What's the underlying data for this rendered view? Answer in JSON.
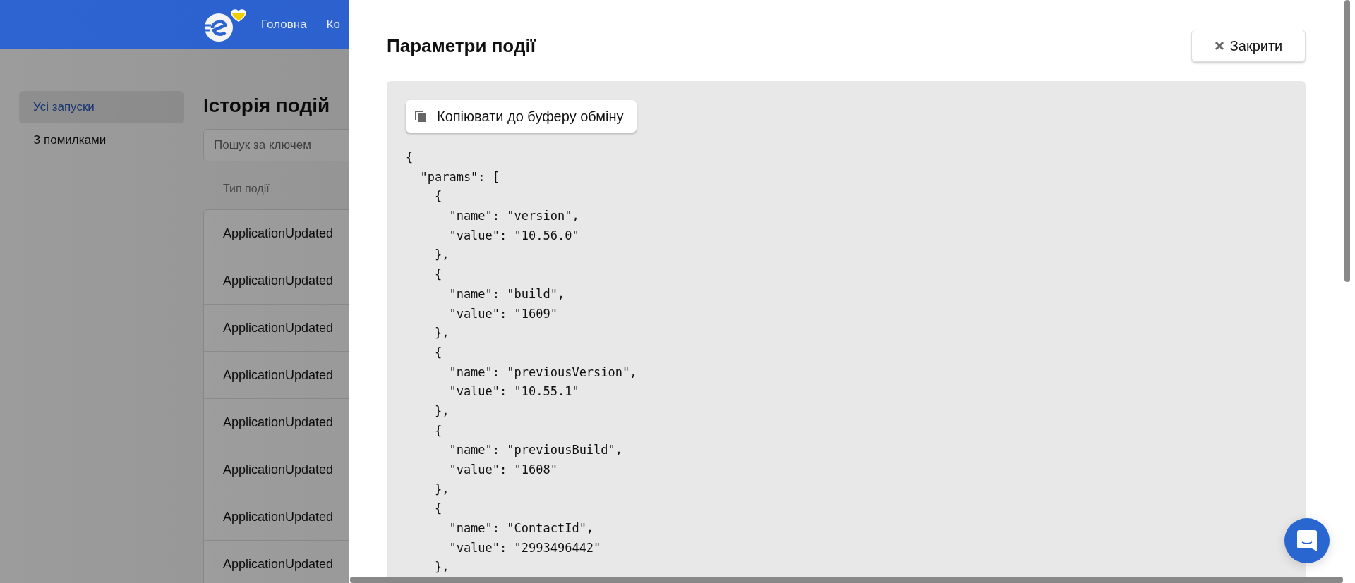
{
  "header": {
    "nav": [
      {
        "label": "Головна"
      },
      {
        "label": "Ко"
      }
    ]
  },
  "sidebar": {
    "items": [
      {
        "label": "Усі запуски",
        "selected": true
      },
      {
        "label": "З помилками",
        "selected": false
      }
    ]
  },
  "content": {
    "title": "Історія подій",
    "search": {
      "placeholder": "Пошук за ключем"
    },
    "table": {
      "columns": [
        "Тип події"
      ],
      "rows": [
        [
          "ApplicationUpdated"
        ],
        [
          "ApplicationUpdated"
        ],
        [
          "ApplicationUpdated"
        ],
        [
          "ApplicationUpdated"
        ],
        [
          "ApplicationUpdated"
        ],
        [
          "ApplicationUpdated"
        ],
        [
          "ApplicationUpdated"
        ],
        [
          "ApplicationUpdated"
        ]
      ]
    }
  },
  "drawer": {
    "title": "Параметри події",
    "close_button": "Закрити",
    "copy_button": "Копіювати до буферу обміну",
    "code_lines": [
      "{",
      "  \"params\": [",
      "    {",
      "      \"name\": \"version\",",
      "      \"value\": \"10.56.0\"",
      "    },",
      "    {",
      "      \"name\": \"build\",",
      "      \"value\": \"1609\"",
      "    },",
      "    {",
      "      \"name\": \"previousVersion\",",
      "      \"value\": \"10.55.1\"",
      "    },",
      "    {",
      "      \"name\": \"previousBuild\",",
      "      \"value\": \"1608\"",
      "    },",
      "    {",
      "      \"name\": \"ContactId\",",
      "      \"value\": \"2993496442\"",
      "    },"
    ]
  }
}
